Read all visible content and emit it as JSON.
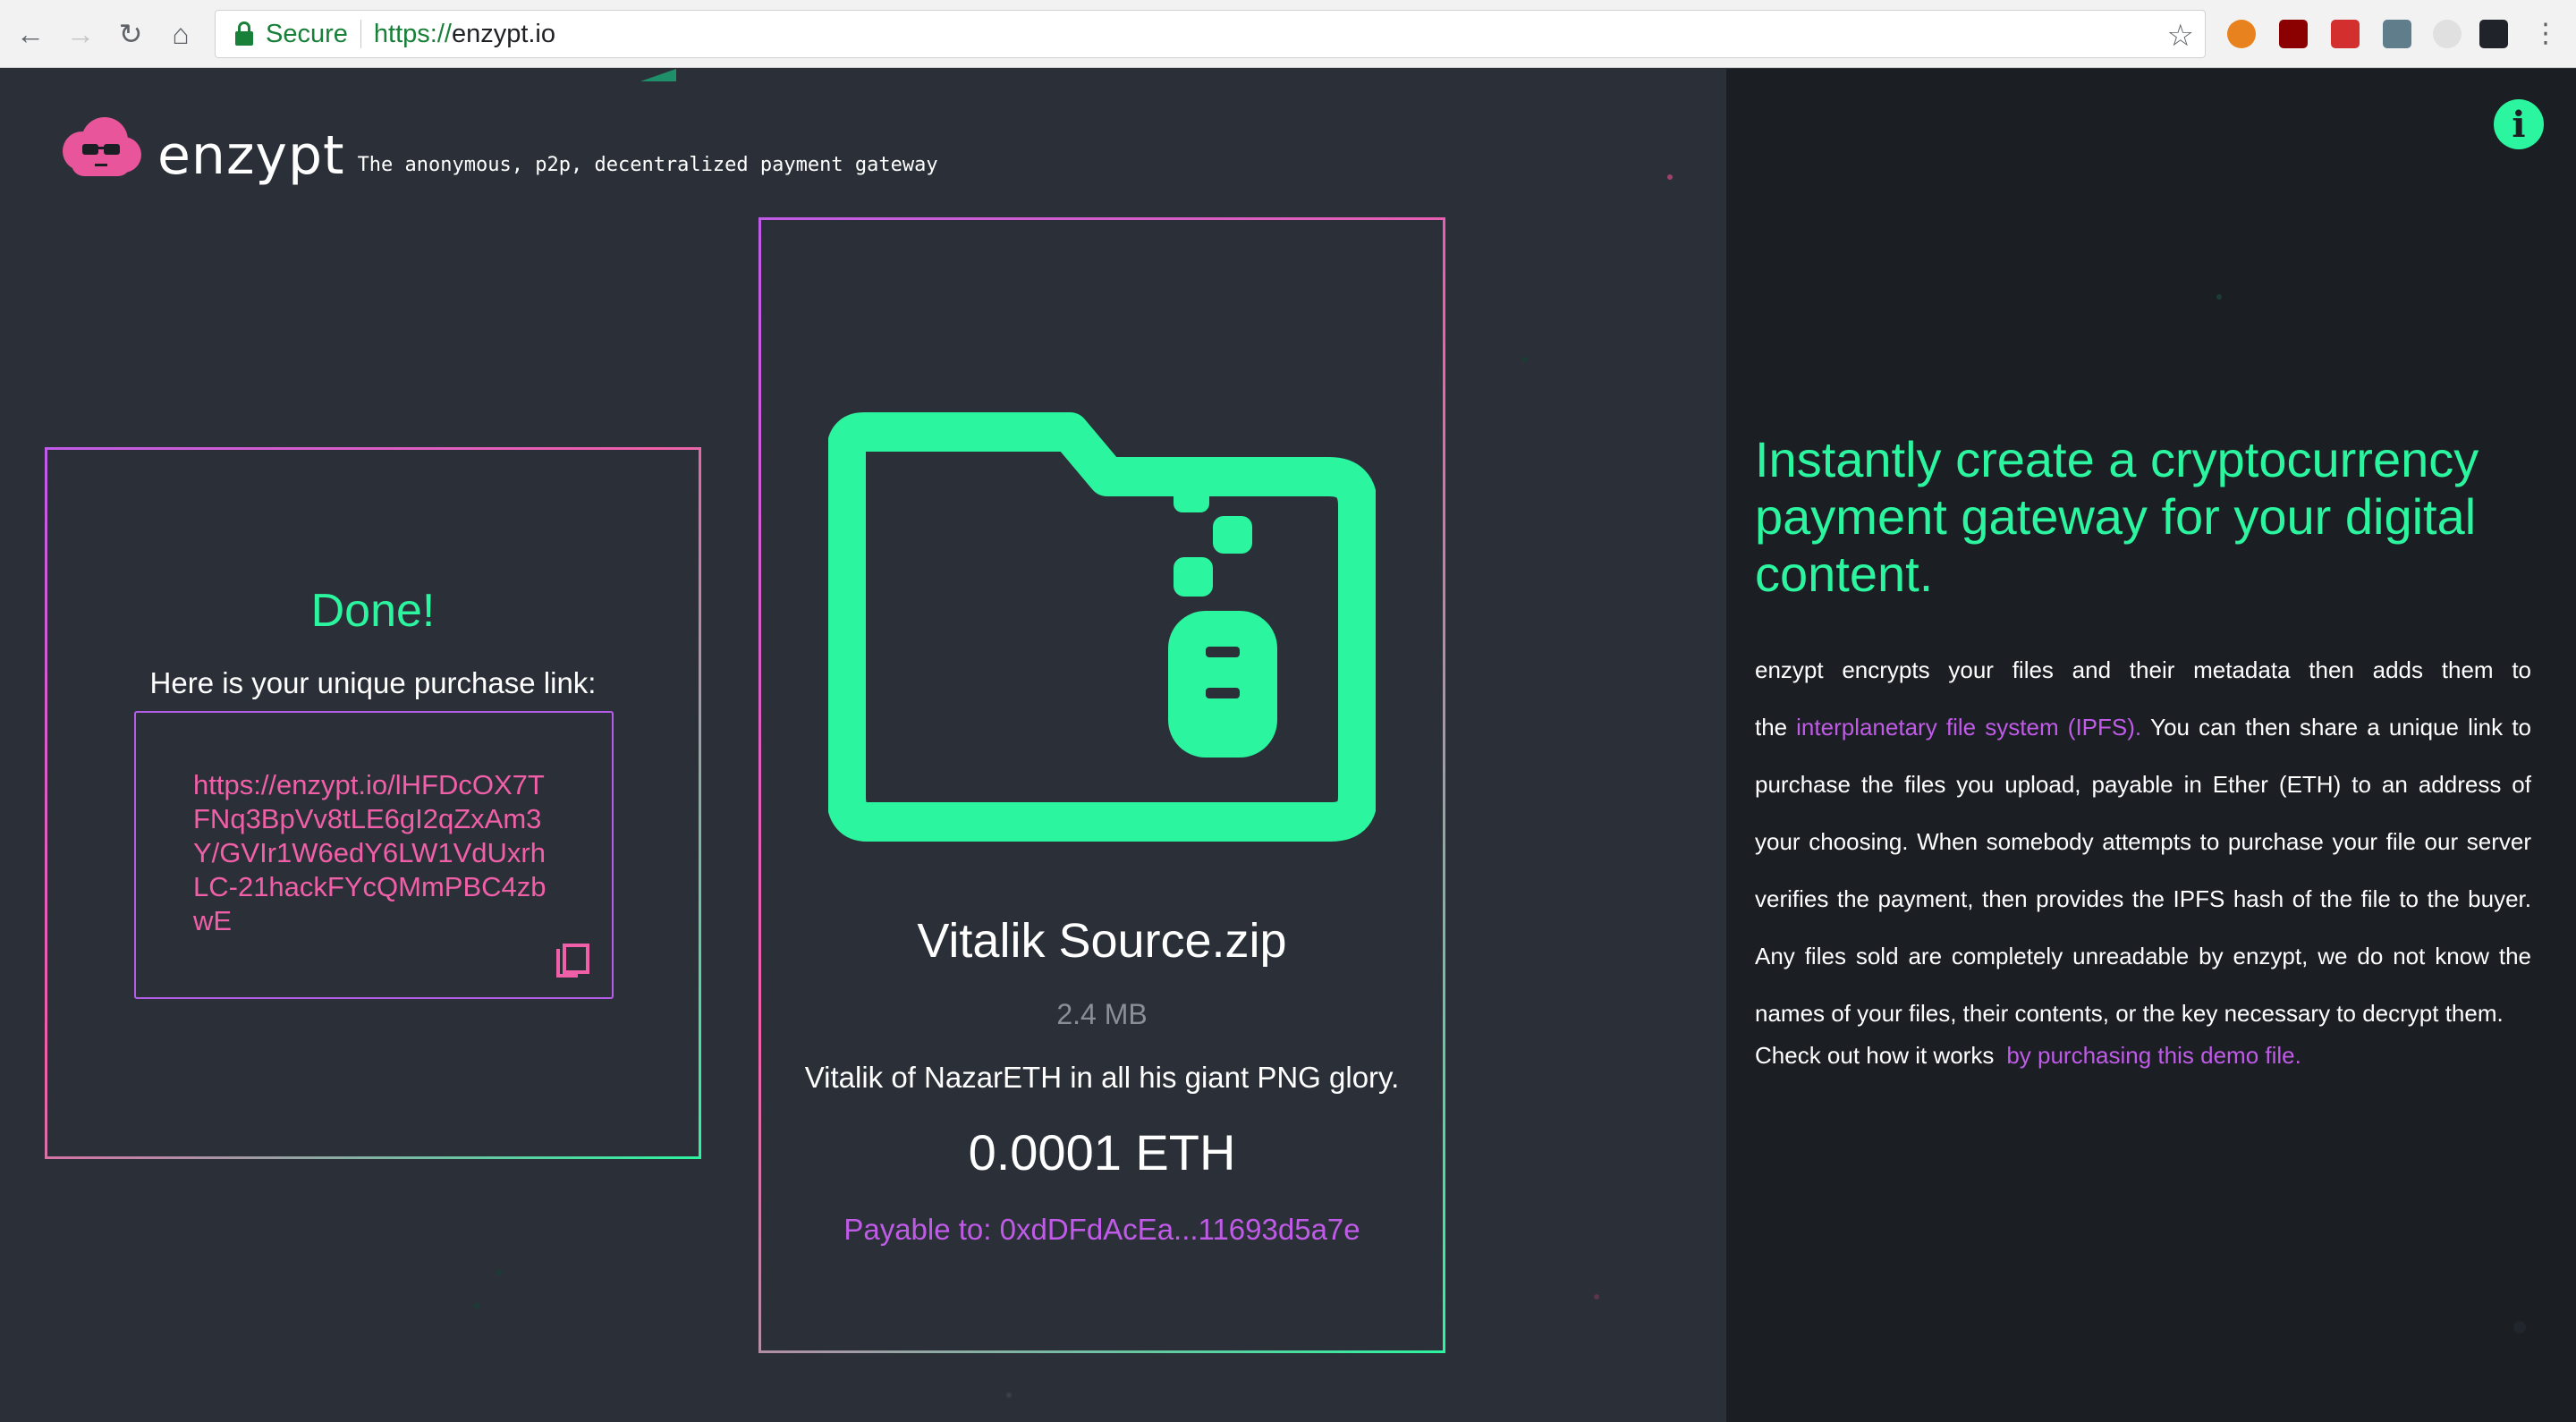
{
  "browser": {
    "secure_label": "Secure",
    "url_scheme": "https://",
    "url_host": "enzypt.io"
  },
  "header": {
    "brand": "enzypt",
    "tagline": "The anonymous, p2p, decentralized payment gateway"
  },
  "done_panel": {
    "title": "Done!",
    "subtitle": "Here is your unique purchase link:",
    "link": "https://enzypt.io/lHFDcOX7TFNq3BpVv8tLE6gI2qZxAm3Y/GVIr1W6edY6LW1VdUxrhLC-21hackFYcQMmPBC4zbwE"
  },
  "file_card": {
    "name": "Vitalik Source.zip",
    "size": "2.4 MB",
    "description": "Vitalik of NazarETH in all his giant PNG glory.",
    "price": "0.0001 ETH",
    "payable": "Payable to: 0xdDFdAcEa...11693d5a7e"
  },
  "info_panel": {
    "headline": "Instantly create a cryptocurrency payment gateway for your digital content.",
    "body_part1": "enzypt encrypts your files and their metadata then adds them to the",
    "ipfs_link": "interplanetary file system (IPFS).",
    "body_part2": "You can then share a unique link to purchase the files you upload, payable in Ether (ETH) to an address of your choosing. When somebody attempts to purchase your file our server verifies the payment, then provides the IPFS hash of the file to the buyer. Any files sold are completely unreadable by enzypt, we do not know the names of your files, their contents, or the key necessary to decrypt them.",
    "howto_text": "Check out how it works",
    "demo_link": "by purchasing this demo file."
  },
  "colors": {
    "accent_green": "#2cf5a0",
    "accent_purple": "#c05be8",
    "accent_pink": "#f05fa8",
    "background": "#2b3038",
    "panel_dark": "#1b1f24"
  },
  "icons": [
    "back-icon",
    "forward-icon",
    "reload-icon",
    "home-icon",
    "lock-icon",
    "star-icon",
    "logo-cloud-icon",
    "copy-icon",
    "folder-zip-icon",
    "info-icon"
  ]
}
